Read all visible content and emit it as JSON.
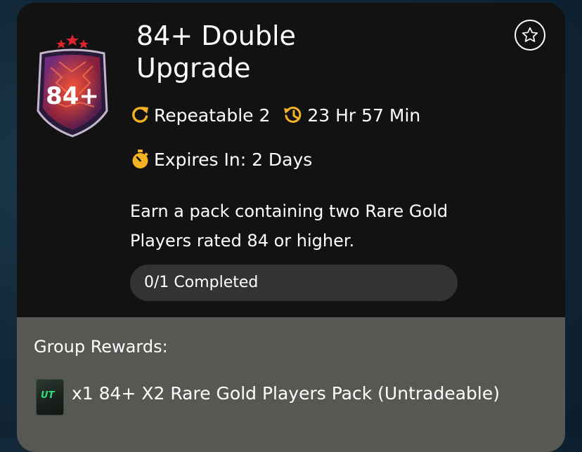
{
  "objective": {
    "title": "84+ Double Upgrade",
    "badge_text": "84+",
    "repeatable_label": "Repeatable 2",
    "timer_label": "23 Hr 57 Min",
    "expires_label": "Expires In: 2 Days",
    "description": "Earn a pack containing two Rare Gold Players rated 84 or higher.",
    "progress": {
      "label": "0/1 Completed",
      "fraction": 0
    }
  },
  "rewards": {
    "title": "Group Rewards:",
    "items": [
      {
        "pack_logo": "UT",
        "label": "x1 84+ X2 Rare Gold Players Pack (Untradeable)"
      }
    ]
  },
  "icons": {
    "badge": "upgrade-badge-icon",
    "favorite": "star-icon",
    "repeatable": "repeat-icon",
    "timer": "history-clock-icon",
    "expires": "stopwatch-icon",
    "pack": "pack-icon"
  },
  "colors": {
    "accent": "#F5B324",
    "card_bg": "#121212",
    "rewards_bg": "#575753",
    "progress_track": "#333333",
    "badge_red": "#C41E2E",
    "badge_purple": "#5B2D7A"
  }
}
